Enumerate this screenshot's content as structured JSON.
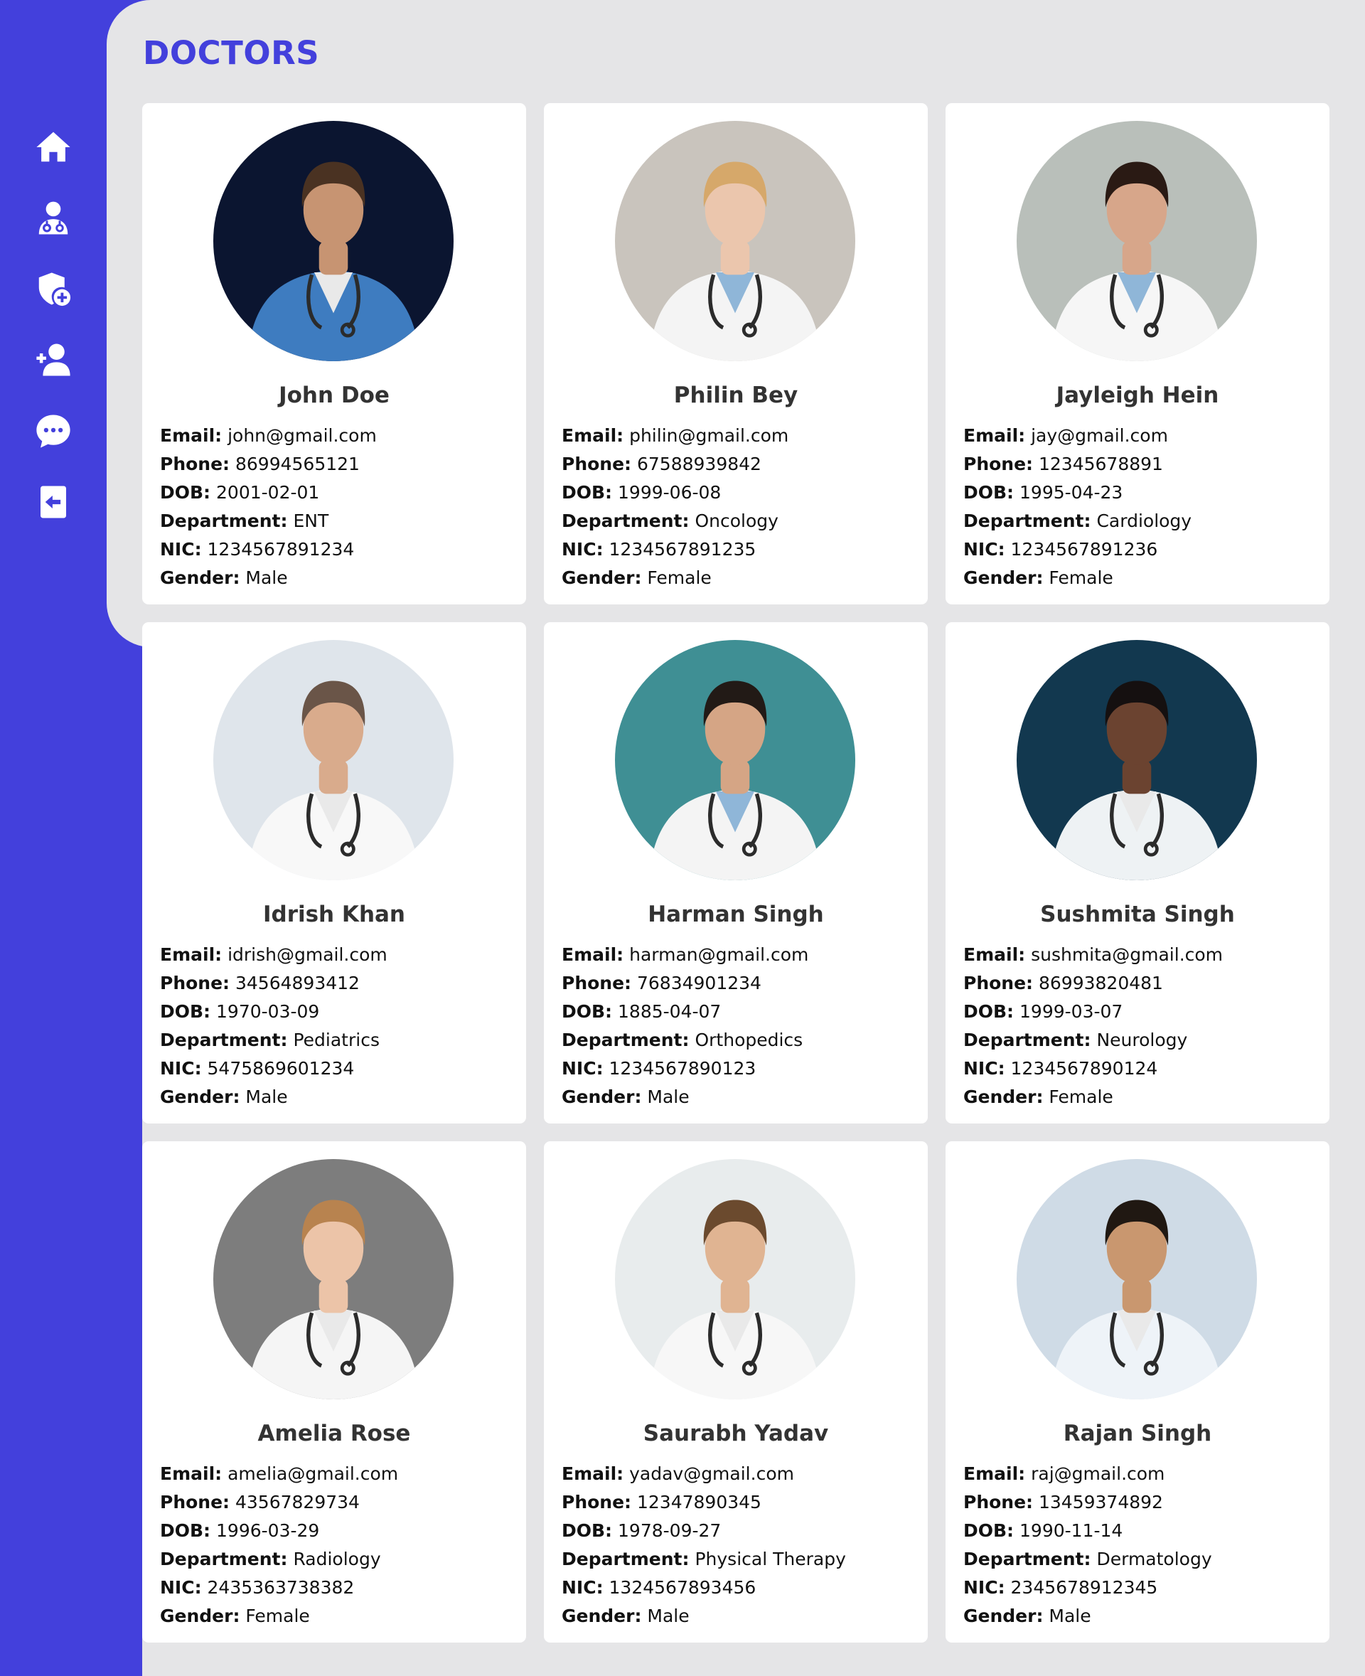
{
  "page": {
    "title": "DOCTORS"
  },
  "sidebar": {
    "items": [
      {
        "icon": "home-icon"
      },
      {
        "icon": "doctor-icon"
      },
      {
        "icon": "shield-plus-icon"
      },
      {
        "icon": "add-user-icon"
      },
      {
        "icon": "chat-icon"
      },
      {
        "icon": "logout-icon"
      }
    ]
  },
  "labels": {
    "email": "Email:",
    "phone": "Phone:",
    "dob": "DOB:",
    "department": "Department:",
    "nic": "NIC:",
    "gender": "Gender:"
  },
  "doctors": [
    {
      "name": "John Doe",
      "email": "john@gmail.com",
      "phone": "86994565121",
      "dob": "2001-02-01",
      "department": "ENT",
      "nic": "1234567891234",
      "gender": "Male"
    },
    {
      "name": "Philin Bey",
      "email": "philin@gmail.com",
      "phone": "67588939842",
      "dob": "1999-06-08",
      "department": "Oncology",
      "nic": "1234567891235",
      "gender": "Female"
    },
    {
      "name": "Jayleigh Hein",
      "email": "jay@gmail.com",
      "phone": "12345678891",
      "dob": "1995-04-23",
      "department": "Cardiology",
      "nic": "1234567891236",
      "gender": "Female"
    },
    {
      "name": "Idrish Khan",
      "email": "idrish@gmail.com",
      "phone": "34564893412",
      "dob": "1970-03-09",
      "department": "Pediatrics",
      "nic": "5475869601234",
      "gender": "Male"
    },
    {
      "name": "Harman Singh",
      "email": "harman@gmail.com",
      "phone": "76834901234",
      "dob": "1885-04-07",
      "department": "Orthopedics",
      "nic": "1234567890123",
      "gender": "Male"
    },
    {
      "name": "Sushmita Singh",
      "email": "sushmita@gmail.com",
      "phone": "86993820481",
      "dob": "1999-03-07",
      "department": "Neurology",
      "nic": "1234567890124",
      "gender": "Female"
    },
    {
      "name": "Amelia Rose",
      "email": "amelia@gmail.com",
      "phone": "43567829734",
      "dob": "1996-03-29",
      "department": "Radiology",
      "nic": "2435363738382",
      "gender": "Female"
    },
    {
      "name": "Saurabh Yadav",
      "email": "yadav@gmail.com",
      "phone": "12347890345",
      "dob": "1978-09-27",
      "department": "Physical Therapy",
      "nic": "1324567893456",
      "gender": "Male"
    },
    {
      "name": "Rajan Singh",
      "email": "raj@gmail.com",
      "phone": "13459374892",
      "dob": "1990-11-14",
      "department": "Dermatology",
      "nic": "2345678912345",
      "gender": "Male"
    }
  ],
  "colors": {
    "accent": "#4340dc",
    "background": "#e5e5e7",
    "card": "#ffffff"
  },
  "photo_palettes": [
    {
      "bg": "#0b1530",
      "coat": "#3e7cc0",
      "skin": "#c79472",
      "hair": "#4a3222"
    },
    {
      "bg": "#c9c4bd",
      "coat": "#f4f4f4",
      "skin": "#ebc6ad",
      "hair": "#d6a86a"
    },
    {
      "bg": "#b9bfba",
      "coat": "#f6f6f6",
      "skin": "#d7a68a",
      "hair": "#2a1a14"
    },
    {
      "bg": "#dfe5eb",
      "coat": "#f8f8f8",
      "skin": "#d9ab8c",
      "hair": "#6a5548"
    },
    {
      "bg": "#3f8f94",
      "coat": "#f4f4f4",
      "skin": "#d5a585",
      "hair": "#221a16"
    },
    {
      "bg": "#12384f",
      "coat": "#eef2f4",
      "skin": "#6b4330",
      "hair": "#151010"
    },
    {
      "bg": "#7d7d7d",
      "coat": "#f5f5f5",
      "skin": "#ecc4a8",
      "hair": "#b8834f"
    },
    {
      "bg": "#e8eced",
      "coat": "#f7f7f7",
      "skin": "#e0b492",
      "hair": "#6b4a2e"
    },
    {
      "bg": "#cfdbe6",
      "coat": "#eef3f8",
      "skin": "#c9976f",
      "hair": "#201812"
    }
  ]
}
